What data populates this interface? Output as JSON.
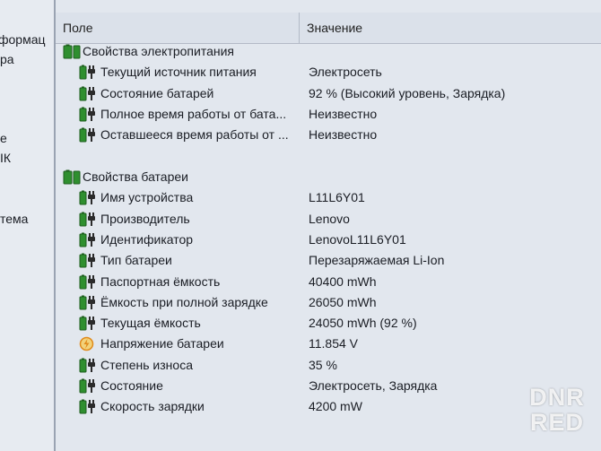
{
  "left_pane": {
    "items": [
      "формац",
      "ра",
      "е",
      "ІК",
      "тема"
    ]
  },
  "columns": {
    "field": "Поле",
    "value": "Значение"
  },
  "groups": [
    {
      "title": "Свойства электропитания",
      "rows": [
        {
          "field": "Текущий источник питания",
          "value": "Электросеть",
          "icon": "battery-plug-icon"
        },
        {
          "field": "Состояние батарей",
          "value": "92 % (Высокий уровень, Зарядка)",
          "icon": "battery-plug-icon"
        },
        {
          "field": "Полное время работы от бата...",
          "value": "Неизвестно",
          "icon": "battery-plug-icon"
        },
        {
          "field": "Оставшееся время работы от ...",
          "value": "Неизвестно",
          "icon": "battery-plug-icon"
        }
      ]
    },
    {
      "title": "Свойства батареи",
      "rows": [
        {
          "field": "Имя устройства",
          "value": "L11L6Y01",
          "icon": "battery-plug-icon"
        },
        {
          "field": "Производитель",
          "value": "Lenovo",
          "icon": "battery-plug-icon"
        },
        {
          "field": "Идентификатор",
          "value": "LenovoL11L6Y01",
          "icon": "battery-plug-icon"
        },
        {
          "field": "Тип батареи",
          "value": "Перезаряжаемая Li-Ion",
          "icon": "battery-plug-icon"
        },
        {
          "field": "Паспортная ёмкость",
          "value": "40400 mWh",
          "icon": "battery-plug-icon"
        },
        {
          "field": "Ёмкость при полной зарядке",
          "value": "26050 mWh",
          "icon": "battery-plug-icon"
        },
        {
          "field": "Текущая ёмкость",
          "value": "24050 mWh  (92 %)",
          "icon": "battery-plug-icon"
        },
        {
          "field": "Напряжение батареи",
          "value": "11.854 V",
          "icon": "voltage-icon"
        },
        {
          "field": "Степень износа",
          "value": "35 %",
          "icon": "battery-plug-icon"
        },
        {
          "field": "Состояние",
          "value": "Электросеть, Зарядка",
          "icon": "battery-plug-icon"
        },
        {
          "field": "Скорость зарядки",
          "value": "4200 mW",
          "icon": "battery-plug-icon"
        }
      ]
    }
  ],
  "watermark": {
    "line1": "DNR",
    "line2": "RED"
  },
  "colors": {
    "battery_green": "#2f8f2f",
    "plug_dark": "#2b2b2b",
    "voltage_orange": "#e08a1a"
  }
}
